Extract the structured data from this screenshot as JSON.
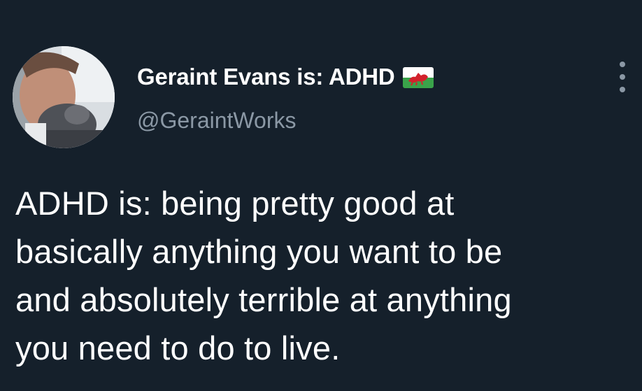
{
  "tweet": {
    "author": {
      "display_name": "Geraint Evans is: ADHD",
      "handle": "@GeraintWorks",
      "avatar": "profile-photo",
      "flag_icon": "wales-flag-icon"
    },
    "more_icon": "more-options-icon",
    "text_lines": [
      "ADHD is: being pretty good at",
      "basically anything you want to be",
      "and absolutely terrible at anything",
      "you need to do to live."
    ]
  },
  "colors": {
    "background": "#15202b",
    "primary_text": "#ffffff",
    "secondary_text": "#8b98a5",
    "flag_green": "#3aa34a",
    "flag_red": "#d3222c"
  }
}
